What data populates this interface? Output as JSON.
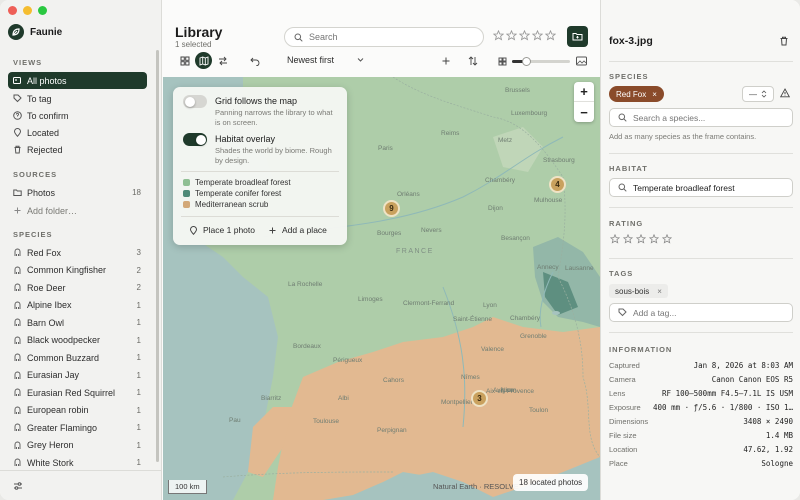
{
  "app": {
    "name": "Faunie"
  },
  "colors": {
    "accent": "#1f3a2b",
    "species_chip": "#8a4b2a",
    "cluster": "#c9a15e"
  },
  "sidebar": {
    "views_title": "VIEWS",
    "views": [
      {
        "label": "All photos",
        "icon": "photos-icon",
        "active": true
      },
      {
        "label": "To tag",
        "icon": "tag-icon"
      },
      {
        "label": "To confirm",
        "icon": "question-icon"
      },
      {
        "label": "Located",
        "icon": "pin-icon"
      },
      {
        "label": "Rejected",
        "icon": "trash-icon"
      }
    ],
    "sources_title": "SOURCES",
    "sources": [
      {
        "label": "Photos",
        "count": "18",
        "icon": "folder-icon"
      }
    ],
    "add_folder": "Add folder…",
    "species_title": "SPECIES",
    "species": [
      {
        "label": "Red Fox",
        "count": "3"
      },
      {
        "label": "Common Kingfisher",
        "count": "2"
      },
      {
        "label": "Roe Deer",
        "count": "2"
      },
      {
        "label": "Alpine Ibex",
        "count": "1"
      },
      {
        "label": "Barn Owl",
        "count": "1"
      },
      {
        "label": "Black woodpecker",
        "count": "1"
      },
      {
        "label": "Common Buzzard",
        "count": "1"
      },
      {
        "label": "Eurasian Jay",
        "count": "1"
      },
      {
        "label": "Eurasian Red Squirrel",
        "count": "1"
      },
      {
        "label": "European robin",
        "count": "1"
      },
      {
        "label": "Greater Flamingo",
        "count": "1"
      },
      {
        "label": "Grey Heron",
        "count": "1"
      },
      {
        "label": "White Stork",
        "count": "1"
      }
    ]
  },
  "library": {
    "title": "Library",
    "subtitle": "1 selected",
    "search_placeholder": "Search",
    "sort_label": "Newest first"
  },
  "map": {
    "panel": {
      "grid_title": "Grid follows the map",
      "grid_desc": "Panning narrows the library to what is on screen.",
      "grid_on": false,
      "habitat_title": "Habitat overlay",
      "habitat_desc": "Shades the world by biome. Rough by design.",
      "habitat_on": true,
      "legend": [
        {
          "label": "Temperate broadleaf forest",
          "color": "#8fbf93"
        },
        {
          "label": "Temperate conifer forest",
          "color": "#4f8a78"
        },
        {
          "label": "Mediterranean scrub",
          "color": "#d2a878"
        }
      ],
      "place_btn": "Place 1 photo",
      "add_place_btn": "Add a place"
    },
    "clusters": [
      {
        "count": "9"
      },
      {
        "count": "4"
      },
      {
        "count": "3"
      }
    ],
    "country_label": "FRANCE",
    "cities": [
      "Brussels",
      "Luxembourg",
      "Reims",
      "Paris",
      "Metz",
      "Strasbourg",
      "Rouen",
      "Orléans",
      "Mulhouse",
      "Le Mans",
      "Tours",
      "Bourges",
      "Nevers",
      "Besançon",
      "Dijon",
      "Nantes",
      "Annecy",
      "Lausanne",
      "Geneva",
      "La Rochelle",
      "Limoges",
      "Clermont-Ferrand",
      "Lyon",
      "Grenoble",
      "Saint-Étienne",
      "Bordeaux",
      "Valence",
      "Nice",
      "Avignon",
      "Nîmes",
      "Marseille",
      "Montpellier",
      "Toulouse",
      "Albi",
      "Biarritz",
      "Pau",
      "Perpignan",
      "Aix-en-Provence",
      "Toulon",
      "Poitiers",
      "Angers",
      "Caen",
      "Amiens",
      "Lille",
      "Troyes",
      "Chambéry",
      "Périgueux",
      "Cahors",
      "Rodez",
      "Agen",
      "Tarbes",
      "Bayonne"
    ],
    "scale": "100 km",
    "attribution": "Natural Earth · RESOLVE",
    "located_count": "18 located photos"
  },
  "detail": {
    "file_name": "fox-3.jpg",
    "species_title": "SPECIES",
    "species_chip": "Red Fox",
    "count_value": "—",
    "species_placeholder": "Search a species...",
    "species_hint": "Add as many species as the frame contains.",
    "habitat_title": "HABITAT",
    "habitat_value": "Temperate broadleaf forest",
    "rating_title": "RATING",
    "rating_value": 0,
    "tags_title": "TAGS",
    "tag": "sous-bois",
    "tag_placeholder": "Add a tag...",
    "info_title": "INFORMATION",
    "info": [
      {
        "k": "Captured",
        "v": "Jan 8, 2026 at 8:03 AM"
      },
      {
        "k": "Camera",
        "v": "Canon Canon EOS R5"
      },
      {
        "k": "Lens",
        "v": "RF 100–500mm F4.5–7.1L IS USM"
      },
      {
        "k": "Exposure",
        "v": "400 mm · ƒ/5.6 · 1/800 · ISO 1…"
      },
      {
        "k": "Dimensions",
        "v": "3408 × 2490"
      },
      {
        "k": "File size",
        "v": "1.4 MB"
      },
      {
        "k": "Location",
        "v": "47.62, 1.92"
      },
      {
        "k": "Place",
        "v": "Sologne"
      }
    ]
  }
}
